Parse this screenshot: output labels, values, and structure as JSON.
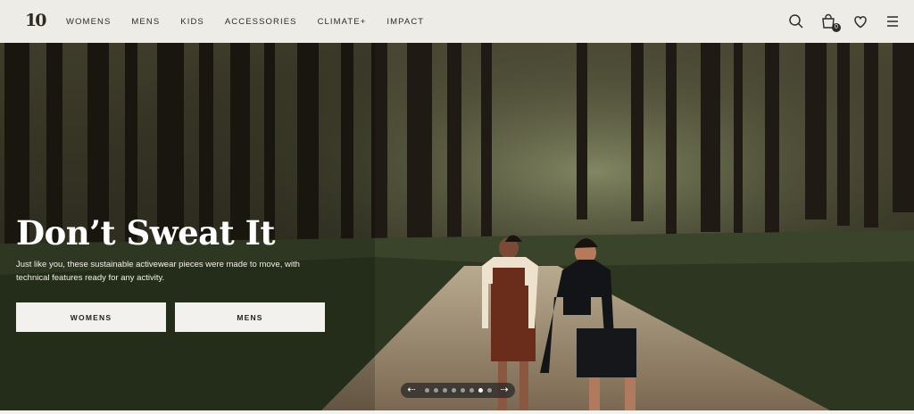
{
  "brand": {
    "logo_text": "10"
  },
  "nav": {
    "items": [
      "WOMENS",
      "MENS",
      "KIDS",
      "ACCESSORIES",
      "CLIMATE+",
      "IMPACT"
    ],
    "icons": [
      "search-icon",
      "cart-icon",
      "heart-icon",
      "menu-icon"
    ],
    "cart_count": "0"
  },
  "hero": {
    "title": "Don’t Sweat It",
    "description": "Just like you, these sustainable activewear pieces were made to move, with technical features ready for any activity.",
    "buttons": [
      "WOMENS",
      "MENS"
    ]
  },
  "carousel": {
    "prev": "⇠",
    "next": "⇢",
    "slides": 8,
    "active_index": 7
  },
  "colors": {
    "nav_bg": "#eeece6",
    "button_bg": "#f2f1ed",
    "text_dark": "#2b2b2b",
    "forest_dark": "#1f1d16",
    "forest_mid": "#4b4128",
    "path": "#b49b78"
  }
}
